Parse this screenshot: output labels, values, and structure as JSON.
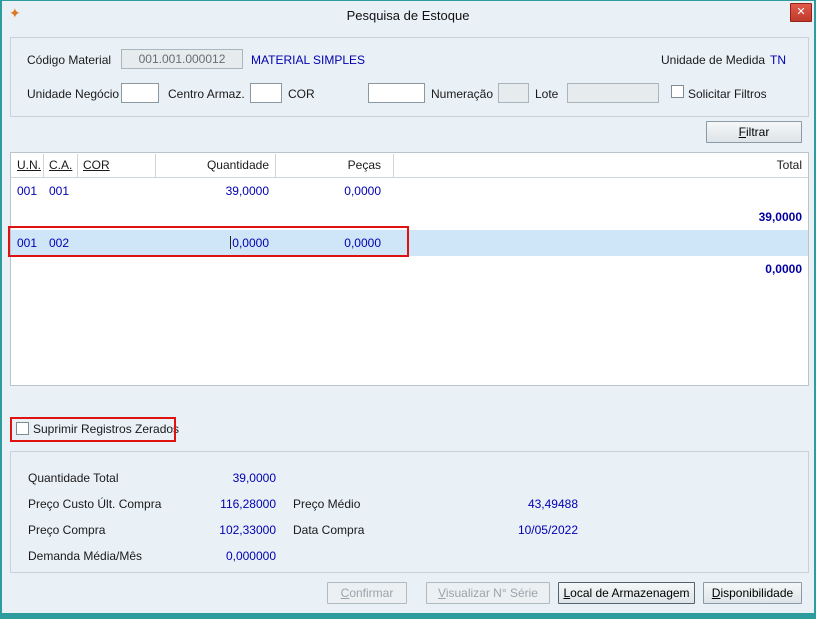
{
  "window": {
    "title": "Pesquisa de Estoque"
  },
  "icons": {
    "app": "✦",
    "close": "✕"
  },
  "colors": {
    "accent_teal": "#2e9c9c",
    "value_blue": "#0000b0",
    "annotation_red": "#e01111",
    "selected_row": "#cfe6f9"
  },
  "filter": {
    "codigo_material": {
      "label": "Código Material",
      "value": "001.001.000012",
      "description": "MATERIAL SIMPLES"
    },
    "unidade_medida": {
      "label": "Unidade de Medida",
      "value": "TN"
    },
    "unidade_negocio": {
      "label": "Unidade Negócio",
      "value": ""
    },
    "centro_armaz": {
      "label": "Centro Armaz.",
      "value": ""
    },
    "cor": {
      "label": "COR",
      "value": ""
    },
    "numeracao": {
      "label": "Numeração",
      "value": ""
    },
    "lote": {
      "label": "Lote",
      "value": ""
    },
    "solicitar_filtros": {
      "label": "Solicitar Filtros",
      "checked": false
    },
    "filtrar_button": "Filtrar"
  },
  "table": {
    "headers": {
      "un": "U.N.",
      "ca": "C.A.",
      "cor": "COR",
      "quantidade": "Quantidade",
      "pecas": "Peças",
      "total": "Total"
    },
    "rows": [
      {
        "un": "001",
        "ca": "001",
        "cor": "",
        "quantidade": "39,0000",
        "pecas": "0,0000"
      },
      {
        "total": "39,0000"
      },
      {
        "un": "001",
        "ca": "002",
        "cor": "",
        "quantidade": "0,0000",
        "pecas": "0,0000",
        "selected": true,
        "editing": true
      },
      {
        "total": "0,0000"
      }
    ]
  },
  "options": {
    "suprimir_registros": {
      "label": "Suprimir Registros Zerados",
      "checked": false
    }
  },
  "summary": {
    "quantidade_total": {
      "label": "Quantidade Total",
      "value": "39,0000"
    },
    "preco_custo": {
      "label": "Preço Custo Últ. Compra",
      "value": "116,28000"
    },
    "preco_medio": {
      "label": "Preço Médio",
      "value": "43,49488"
    },
    "preco_compra": {
      "label": "Preço Compra",
      "value": "102,33000"
    },
    "data_compra": {
      "label": "Data Compra",
      "value": "10/05/2022"
    },
    "demanda_media": {
      "label": "Demanda Média/Mês",
      "value": "0,000000"
    }
  },
  "actions": {
    "confirmar": "Confirmar",
    "visualizar_serie": "Visualizar N° Série",
    "local_armazenagem": "Local de Armazenagem",
    "disponibilidade": "Disponibilidade"
  }
}
